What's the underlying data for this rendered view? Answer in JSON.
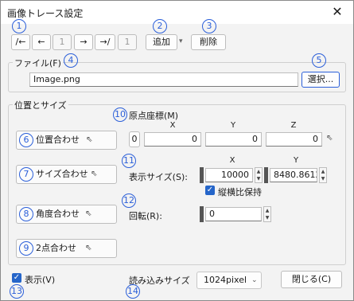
{
  "window": {
    "title": "画像トレース設定",
    "close_glyph": "✕"
  },
  "toolbar": {
    "first_label": "/←",
    "prev_label": "←",
    "index_value": "1",
    "next_label": "→",
    "last_label": "→/",
    "count_value": "1",
    "add_label": "追加",
    "add_dropdown_glyph": "▾",
    "delete_label": "削除"
  },
  "file": {
    "group_label": "ファイル(F)",
    "filename": "Image.png",
    "select_label": "選択..."
  },
  "position": {
    "group_label": "位置とサイズ",
    "origin_label": "原点座標(M)",
    "origin_index": "0",
    "col_x": "X",
    "col_y": "Y",
    "col_z": "Z",
    "origin_x": "0",
    "origin_y": "0",
    "origin_z": "0",
    "btn_position": "位置合わせ",
    "btn_size": "サイズ合わせ",
    "btn_angle": "角度合わせ",
    "btn_two_point": "2点合わせ",
    "display_size_label": "表示サイズ(S):",
    "size_col_x": "X",
    "size_col_y": "Y",
    "size_x": "10000",
    "size_y": "8480.86124",
    "keep_aspect_label": "縦横比保持",
    "keep_aspect_checked": true,
    "rotation_label": "回転(R):",
    "rotation_value": "0"
  },
  "footer": {
    "show_label": "表示(V)",
    "show_checked": true,
    "load_size_label": "読み込みサイズ",
    "load_size_value": "1024pixel",
    "close_label": "閉じる(C)"
  },
  "callouts": [
    "1",
    "2",
    "3",
    "4",
    "5",
    "6",
    "7",
    "8",
    "9",
    "10",
    "11",
    "12",
    "13",
    "14"
  ],
  "colors": {
    "callout": "#2b5fd9",
    "check": "#2565c9"
  }
}
